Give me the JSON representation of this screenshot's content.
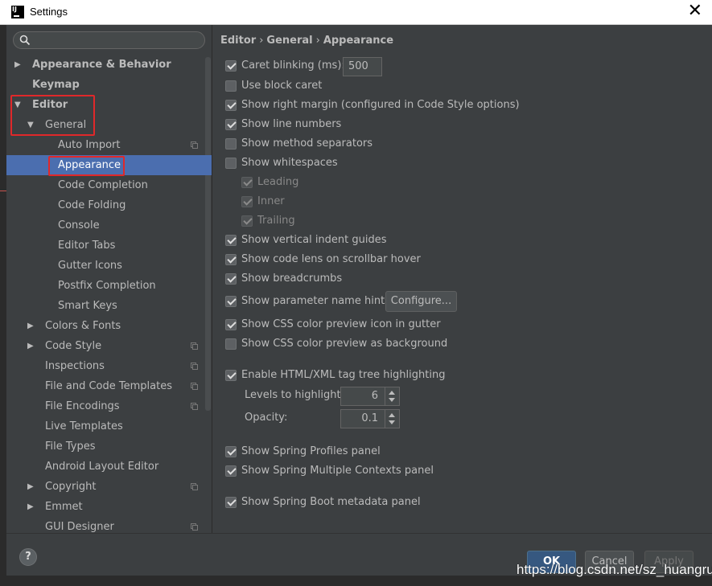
{
  "window": {
    "title": "Settings",
    "app_icon_text": "IJ",
    "close_glyph": "✕"
  },
  "search": {
    "placeholder": ""
  },
  "tree": [
    {
      "label": "Appearance & Behavior",
      "bold": true,
      "arrow": "right"
    },
    {
      "label": "Keymap",
      "bold": true,
      "arrow": ""
    },
    {
      "label": "Editor",
      "bold": true,
      "arrow": "down"
    },
    {
      "label": "General",
      "bold": false,
      "arrow": "down"
    },
    {
      "label": "Auto Import",
      "copy": true
    },
    {
      "label": "Appearance",
      "selected": true
    },
    {
      "label": "Code Completion"
    },
    {
      "label": "Code Folding"
    },
    {
      "label": "Console"
    },
    {
      "label": "Editor Tabs"
    },
    {
      "label": "Gutter Icons"
    },
    {
      "label": "Postfix Completion"
    },
    {
      "label": "Smart Keys"
    },
    {
      "label": "Colors & Fonts",
      "arrow": "right"
    },
    {
      "label": "Code Style",
      "arrow": "right",
      "copy": true
    },
    {
      "label": "Inspections",
      "copy": true
    },
    {
      "label": "File and Code Templates",
      "copy": true
    },
    {
      "label": "File Encodings",
      "copy": true
    },
    {
      "label": "Live Templates"
    },
    {
      "label": "File Types"
    },
    {
      "label": "Android Layout Editor"
    },
    {
      "label": "Copyright",
      "arrow": "right",
      "copy": true
    },
    {
      "label": "Emmet",
      "arrow": "right"
    },
    {
      "label": "GUI Designer",
      "copy": true
    }
  ],
  "breadcrumb": {
    "part1": "Editor",
    "sep": "›",
    "part2": "General",
    "part3": "Appearance"
  },
  "options": {
    "caret_blinking": {
      "label": "Caret blinking (ms):",
      "checked": true,
      "value": "500"
    },
    "block_caret": {
      "label": "Use block caret",
      "checked": false
    },
    "right_margin": {
      "label": "Show right margin (configured in Code Style options)",
      "checked": true
    },
    "line_numbers": {
      "label": "Show line numbers",
      "checked": true
    },
    "method_separators": {
      "label": "Show method separators",
      "checked": false
    },
    "whitespaces": {
      "label": "Show whitespaces",
      "checked": false
    },
    "leading": {
      "label": "Leading",
      "checked": true,
      "disabled": true
    },
    "inner": {
      "label": "Inner",
      "checked": true,
      "disabled": true
    },
    "trailing": {
      "label": "Trailing",
      "checked": true,
      "disabled": true
    },
    "indent_guides": {
      "label": "Show vertical indent guides",
      "checked": true
    },
    "code_lens": {
      "label": "Show code lens on scrollbar hover",
      "checked": true
    },
    "breadcrumbs": {
      "label": "Show breadcrumbs",
      "checked": true
    },
    "param_hints": {
      "label": "Show parameter name hints",
      "checked": true,
      "button": "Configure..."
    },
    "css_icon": {
      "label": "Show CSS color preview icon in gutter",
      "checked": true
    },
    "css_bg": {
      "label": "Show CSS color preview as background",
      "checked": false
    },
    "tag_tree": {
      "label": "Enable HTML/XML tag tree highlighting",
      "checked": true
    },
    "levels": {
      "label": "Levels to highlight:",
      "value": "6"
    },
    "opacity": {
      "label": "Opacity:",
      "value": "0.1"
    },
    "spring_profiles": {
      "label": "Show Spring Profiles panel",
      "checked": true
    },
    "spring_contexts": {
      "label": "Show Spring Multiple Contexts panel",
      "checked": true
    },
    "spring_boot": {
      "label": "Show Spring Boot metadata panel",
      "checked": true
    }
  },
  "footer": {
    "help": "?",
    "ok": "OK",
    "cancel": "Cancel",
    "apply": "Apply"
  },
  "watermark": "https://blog.csdn.net/sz_huangrui",
  "colors": {
    "selection": "#4b6eaf",
    "highlight_box": "#e0282a",
    "background": "#3c3f41"
  }
}
